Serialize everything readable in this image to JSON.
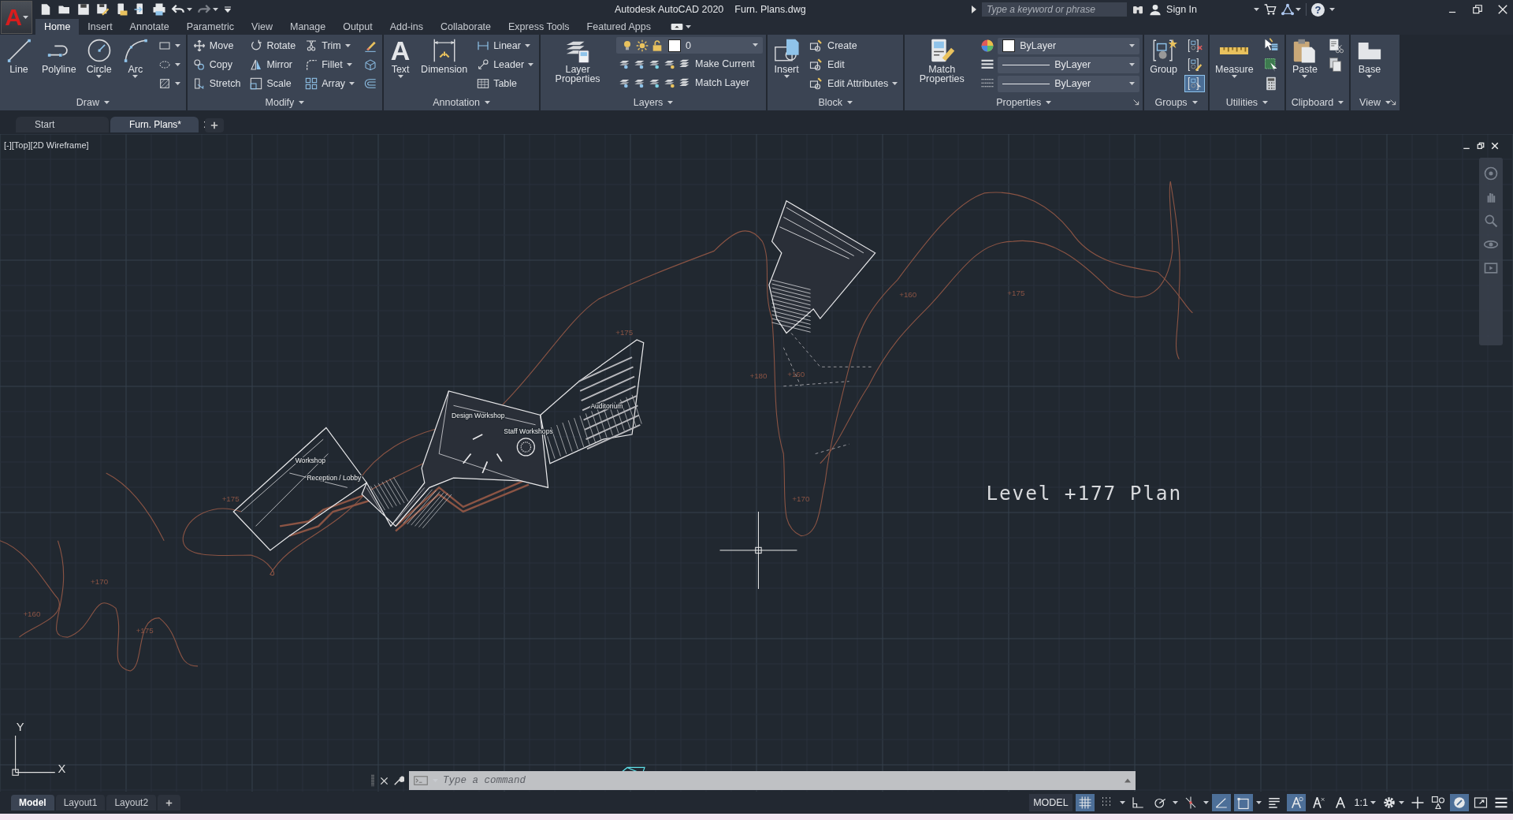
{
  "header": {
    "app_logo": "A",
    "app_title": "Autodesk AutoCAD 2020",
    "file_name": "Furn. Plans.dwg",
    "search": {
      "placeholder": "Type a keyword or phrase"
    },
    "sign_in": "Sign In",
    "help": "?"
  },
  "ribbon_tabs": [
    {
      "label": "Home",
      "selected": true
    },
    {
      "label": "Insert",
      "selected": false
    },
    {
      "label": "Annotate",
      "selected": false
    },
    {
      "label": "Parametric",
      "selected": false
    },
    {
      "label": "View",
      "selected": false
    },
    {
      "label": "Manage",
      "selected": false
    },
    {
      "label": "Output",
      "selected": false
    },
    {
      "label": "Add-ins",
      "selected": false
    },
    {
      "label": "Collaborate",
      "selected": false
    },
    {
      "label": "Express Tools",
      "selected": false
    },
    {
      "label": "Featured Apps",
      "selected": false
    }
  ],
  "panels": [
    {
      "title": "Draw",
      "launcher": false,
      "columns": [
        {
          "kind": "large",
          "label": "Line",
          "caret": false
        },
        {
          "kind": "large",
          "label": "Polyline",
          "caret": false
        },
        {
          "kind": "large",
          "label": "Circle",
          "caret": true
        },
        {
          "kind": "large",
          "label": "Arc",
          "caret": true
        },
        {
          "kind": "stack",
          "rows": [
            {
              "kind": "tool",
              "caret": true
            },
            {
              "kind": "tool",
              "caret": true
            },
            {
              "kind": "tool",
              "caret": true
            }
          ]
        }
      ]
    },
    {
      "title": "Modify",
      "launcher": false,
      "columns": [
        {
          "kind": "stack",
          "rows": [
            {
              "kind": "tool",
              "label": "Move",
              "caret": false
            },
            {
              "kind": "tool",
              "label": "Copy",
              "caret": false
            },
            {
              "kind": "tool",
              "label": "Stretch",
              "caret": false
            }
          ]
        },
        {
          "kind": "stack",
          "rows": [
            {
              "kind": "tool",
              "label": "Rotate",
              "caret": false
            },
            {
              "kind": "tool",
              "label": "Mirror",
              "caret": false
            },
            {
              "kind": "tool",
              "label": "Scale",
              "caret": false
            }
          ]
        },
        {
          "kind": "stack",
          "rows": [
            {
              "kind": "tool",
              "label": "Trim",
              "caret": true
            },
            {
              "kind": "tool",
              "label": "Fillet",
              "caret": true
            },
            {
              "kind": "tool",
              "label": "Array",
              "caret": true
            }
          ]
        },
        {
          "kind": "stack",
          "rows": [
            {
              "kind": "tool",
              "caret": false
            },
            {
              "kind": "tool",
              "caret": false
            },
            {
              "kind": "tool",
              "caret": false
            }
          ]
        }
      ]
    },
    {
      "title": "Annotation",
      "launcher": false,
      "columns": [
        {
          "kind": "large",
          "label": "Text",
          "glyph": "A",
          "caret": true
        },
        {
          "kind": "large",
          "label": "Dimension",
          "caret": false
        },
        {
          "kind": "stack",
          "rows": [
            {
              "kind": "tool",
              "label": "Linear",
              "caret": true
            },
            {
              "kind": "tool",
              "label": "Leader",
              "caret": true
            },
            {
              "kind": "tool",
              "label": "Table",
              "caret": false
            }
          ]
        }
      ]
    },
    {
      "title": "Layers",
      "launcher": false,
      "columns": [
        {
          "kind": "large",
          "label": "Layer Properties",
          "caret": false
        },
        {
          "kind": "stack",
          "rows": [
            {
              "kind": "layer-dropdown",
              "value": "0"
            },
            {
              "kind": "tool",
              "label": "Make Current",
              "caret": false
            },
            {
              "kind": "tool",
              "label": "Match Layer",
              "caret": false
            }
          ]
        }
      ]
    },
    {
      "title": "Block",
      "launcher": false,
      "columns": [
        {
          "kind": "large",
          "label": "Insert",
          "caret": true
        },
        {
          "kind": "stack",
          "rows": [
            {
              "kind": "tool",
              "label": "Create",
              "caret": false
            },
            {
              "kind": "tool",
              "label": "Edit",
              "caret": false
            },
            {
              "kind": "tool",
              "label": "Edit Attributes",
              "caret": true
            }
          ]
        }
      ]
    },
    {
      "title": "Properties",
      "launcher": true,
      "columns": [
        {
          "kind": "large",
          "label": "Match Properties",
          "caret": false
        },
        {
          "kind": "stack",
          "rows": [
            {
              "kind": "swatch-dropdown",
              "value": "ByLayer"
            },
            {
              "kind": "line-dropdown",
              "value": "ByLayer"
            },
            {
              "kind": "line-dropdown",
              "value": "ByLayer"
            }
          ]
        }
      ]
    },
    {
      "title": "Groups",
      "launcher": false,
      "columns": [
        {
          "kind": "large",
          "label": "Group",
          "caret": false
        },
        {
          "kind": "stack",
          "rows": [
            {
              "kind": "tool",
              "caret": false,
              "on": false
            },
            {
              "kind": "tool",
              "caret": false,
              "on": false
            },
            {
              "kind": "tool",
              "caret": false,
              "on": true
            }
          ]
        }
      ]
    },
    {
      "title": "Utilities",
      "launcher": false,
      "columns": [
        {
          "kind": "large",
          "label": "Measure",
          "caret": true
        },
        {
          "kind": "stack",
          "rows": [
            {
              "kind": "tool",
              "caret": false
            },
            {
              "kind": "tool",
              "caret": false
            },
            {
              "kind": "tool",
              "caret": false
            }
          ]
        }
      ]
    },
    {
      "title": "Clipboard",
      "launcher": false,
      "columns": [
        {
          "kind": "large",
          "label": "Paste",
          "caret": true
        },
        {
          "kind": "stack",
          "rows": [
            {
              "kind": "tool",
              "caret": false
            },
            {
              "kind": "tool",
              "caret": false
            }
          ]
        }
      ]
    },
    {
      "title": "View",
      "launcher": true,
      "columns": [
        {
          "kind": "large",
          "label": "Base",
          "caret": true
        }
      ]
    }
  ],
  "doc_tabs": [
    {
      "label": "Start",
      "selected": false,
      "closable": false
    },
    {
      "label": "Furn. Plans*",
      "selected": true,
      "closable": true
    }
  ],
  "viewport": {
    "label": "[-][Top][2D Wireframe]",
    "plan_title": "Level +177 Plan",
    "contour_labels": [
      "+175",
      "+160",
      "+175",
      "+180",
      "+160",
      "+170",
      "+175",
      "+170",
      "+160",
      "+175"
    ],
    "room_labels": [
      "Workshop",
      "Reception / Lobby",
      "Design Workshop",
      "Staff Workshops",
      "Auditorium"
    ],
    "ucs": {
      "y": "Y",
      "x": "X"
    },
    "command_line": {
      "placeholder": "Type a command"
    }
  },
  "layout_tabs": [
    {
      "label": "Model",
      "selected": true
    },
    {
      "label": "Layout1",
      "selected": false
    },
    {
      "label": "Layout2",
      "selected": false
    }
  ],
  "status_bar": {
    "model": "MODEL",
    "scale": "1:1",
    "toggles": [
      {
        "on": true
      },
      {
        "on": false
      },
      {
        "on": false
      },
      {
        "on": false
      },
      {
        "on": false
      },
      {
        "on": true
      },
      {
        "on": true
      },
      {
        "on": false
      },
      {
        "on": true
      },
      {
        "on": false
      },
      {
        "on": false
      }
    ]
  }
}
